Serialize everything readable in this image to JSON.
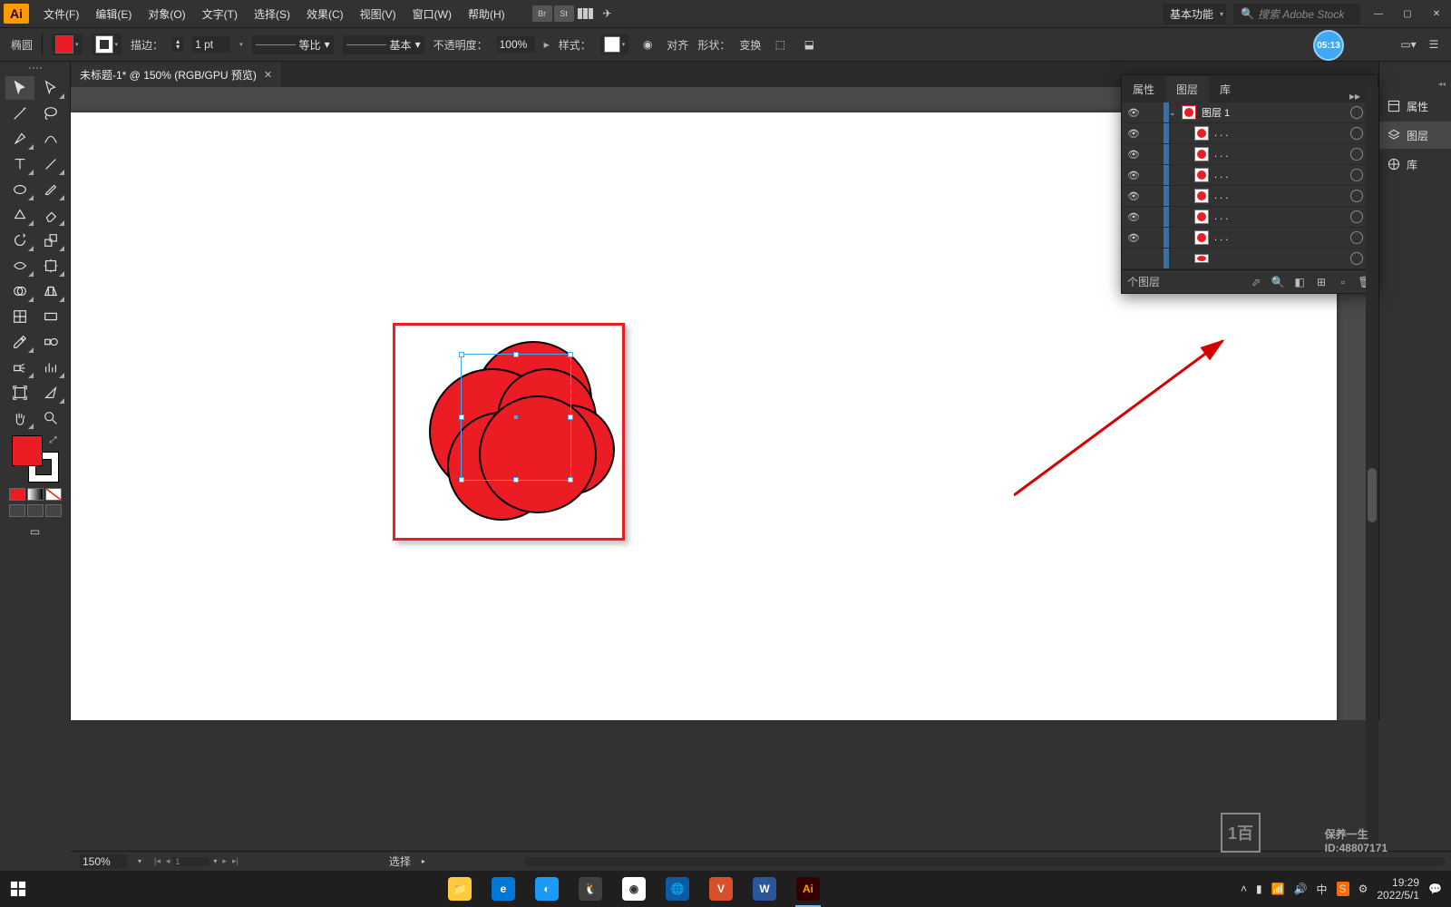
{
  "menubar": {
    "app_logo": "Ai",
    "items": [
      "文件(F)",
      "编辑(E)",
      "对象(O)",
      "文字(T)",
      "选择(S)",
      "效果(C)",
      "视图(V)",
      "窗口(W)",
      "帮助(H)"
    ],
    "workspace": "基本功能",
    "search_placeholder": "搜索 Adobe Stock",
    "stock_icons": [
      "Br",
      "St"
    ]
  },
  "optionsbar": {
    "tool_label": "椭圆",
    "stroke_label": "描边：",
    "stroke_weight": "1 pt",
    "profile_label": "等比",
    "brush_label": "基本",
    "opacity_label": "不透明度：",
    "opacity_value": "100%",
    "style_label": "样式：",
    "align_label": "对齐",
    "shape_label": "形状：",
    "transform_label": "变换",
    "timer": "05:13"
  },
  "document": {
    "tab_title": "未标题-1* @ 150% (RGB/GPU 预览)"
  },
  "statusbar": {
    "zoom": "150%",
    "artboard_num": "1",
    "mode": "选择"
  },
  "layers_panel": {
    "tabs": [
      "属性",
      "图层",
      "库"
    ],
    "active_tab": 1,
    "top_layer": "图层 1",
    "sub_items": [
      ". . .",
      ". . .",
      ". . .",
      ". . .",
      ". . .",
      ". . ."
    ],
    "footer_label": "个图层"
  },
  "rdock": {
    "items": [
      {
        "icon": "props",
        "label": "属性"
      },
      {
        "icon": "layers",
        "label": "图层"
      },
      {
        "icon": "lib",
        "label": "库"
      }
    ],
    "active": 1
  },
  "taskbar": {
    "time": "19:29",
    "date": "2022/5/1"
  },
  "watermark": {
    "line1": "保养一生",
    "line2": "ID:48807171"
  }
}
